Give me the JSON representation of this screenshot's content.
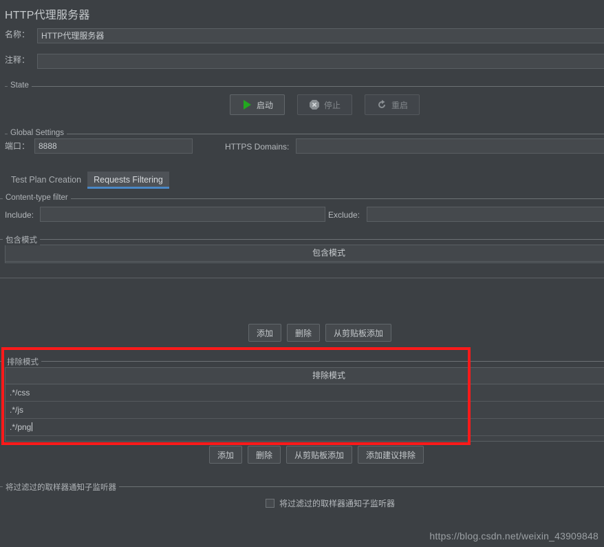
{
  "window": {
    "title": "HTTP代理服务器"
  },
  "name_row": {
    "label": "名称：",
    "value": "HTTP代理服务器"
  },
  "comment_row": {
    "label": "注释：",
    "value": "",
    "placeholder": ""
  },
  "state": {
    "group_title": "State",
    "buttons": [
      {
        "label": "启动",
        "icon": "play-icon",
        "enabled": true
      },
      {
        "label": "停止",
        "icon": "stop-icon",
        "enabled": false
      },
      {
        "label": "重启",
        "icon": "restart-icon",
        "enabled": false
      }
    ]
  },
  "global_settings": {
    "group_title": "Global Settings",
    "port_label": "端口：",
    "port_value": "8888",
    "https_domains_label": "HTTPS Domains:",
    "https_domains_value": ""
  },
  "tabs": [
    {
      "label": "Test Plan Creation",
      "active": false
    },
    {
      "label": "Requests Filtering",
      "active": true
    }
  ],
  "content_type_filter": {
    "group_title": "Content-type filter",
    "include_label": "Include:",
    "include_value": "",
    "exclude_label": "Exclude:",
    "exclude_value": ""
  },
  "include_patterns": {
    "group_title": "包含模式",
    "column_header": "包含模式",
    "rows": [],
    "buttons": [
      {
        "label": "添加"
      },
      {
        "label": "删除"
      },
      {
        "label": "从剪贴板添加"
      }
    ]
  },
  "exclude_patterns": {
    "group_title": "排除模式",
    "column_header": "排除模式",
    "rows": [
      ".*/css",
      ".*/js",
      ".*/png"
    ],
    "editing_row_index": 2,
    "buttons": [
      {
        "label": "添加"
      },
      {
        "label": "删除"
      },
      {
        "label": "从剪贴板添加"
      },
      {
        "label": "添加建议排除"
      }
    ],
    "highlight_color": "#ff1a1a"
  },
  "notify_listeners": {
    "group_title": "将过滤过的取样器通知子监听器",
    "checkbox_label": "将过滤过的取样器通知子监听器",
    "checked": false
  },
  "watermark": {
    "text": "https://blog.csdn.net/weixin_43909848"
  },
  "theme": {
    "background": "#3c4044",
    "field_background": "#45494d",
    "accent_blue": "#4a88c7",
    "play_green": "#22a81f",
    "text": "#b8bcbf"
  }
}
